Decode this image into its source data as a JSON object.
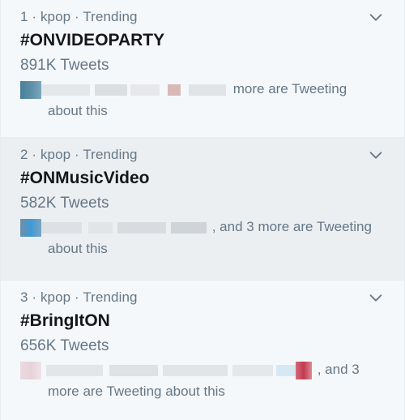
{
  "trends": [
    {
      "meta": "1 · kpop · Trending",
      "hashtag": "#ONVIDEOPARTY",
      "count": "891K Tweets",
      "tweeting_line1": "more are Tweeting",
      "tweeting_line2": "about this"
    },
    {
      "meta": "2 · kpop · Trending",
      "hashtag": "#ONMusicVideo",
      "count": "582K Tweets",
      "tweeting_line1": ", and 3 more are Tweeting",
      "tweeting_line2": "about this"
    },
    {
      "meta": "3 · kpop · Trending",
      "hashtag": "#BringItON",
      "count": "656K Tweets",
      "tweeting_line1": ", and 3",
      "tweeting_line2": "more are Tweeting about this"
    }
  ],
  "icons": {
    "chevron": "chevron-down-icon"
  },
  "colors": {
    "meta_text": "#657786",
    "hashtag_text": "#14171a",
    "hover_bg": "#eceff2",
    "base_bg": "#f5f8fa"
  }
}
